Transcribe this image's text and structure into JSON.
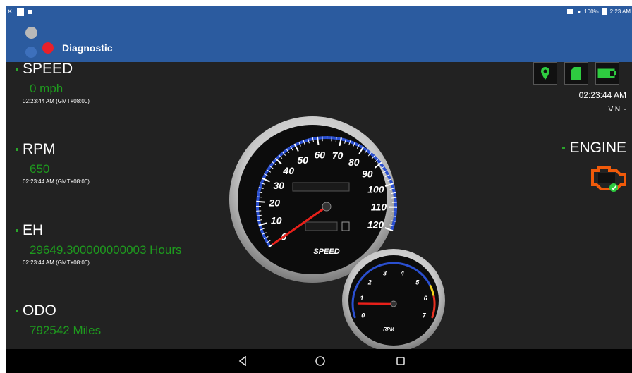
{
  "statusbar": {
    "battery": "100%",
    "time": "2:23 AM"
  },
  "app": {
    "title": "Diagnostic"
  },
  "stats": {
    "speed": {
      "label": "SPEED",
      "value": "0 mph",
      "timestamp": "02:23:44 AM (GMT+08:00)"
    },
    "rpm": {
      "label": "RPM",
      "value": "650",
      "timestamp": "02:23:44 AM (GMT+08:00)"
    },
    "eh": {
      "label": "EH",
      "value": "29649.300000000003 Hours",
      "timestamp": "02:23:44 AM (GMT+08:00)"
    },
    "odo": {
      "label": "ODO",
      "value": "792542 Miles"
    }
  },
  "status_icons": [
    "location-icon",
    "sd-card-icon",
    "battery-icon"
  ],
  "right_panel": {
    "time": "02:23:44 AM",
    "vin": "VIN: -",
    "engine_label": "ENGINE"
  },
  "speedometer": {
    "ticks": [
      "0",
      "10",
      "20",
      "30",
      "40",
      "50",
      "60",
      "70",
      "80",
      "90",
      "100",
      "110",
      "120"
    ],
    "label": "SPEED",
    "value": 0
  },
  "tachometer": {
    "ticks": [
      "0",
      "1",
      "2",
      "3",
      "4",
      "5",
      "6",
      "7"
    ],
    "label": "RPM",
    "value": 0.65
  },
  "colors": {
    "appbar": "#2b5b9f",
    "value_green": "#1e9a1e",
    "engine_orange": "#f05a0a",
    "needle_red": "#e8201a",
    "gauge_blue": "#2a4fd0"
  }
}
